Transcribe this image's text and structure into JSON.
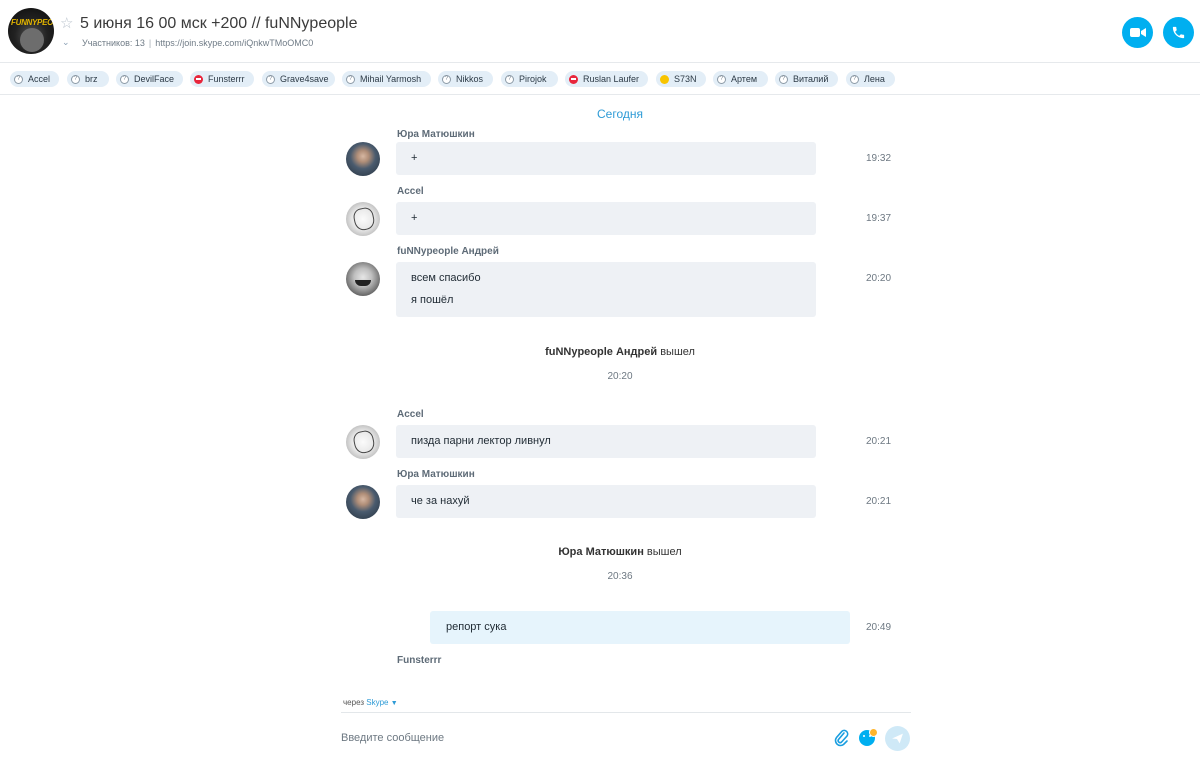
{
  "header": {
    "avatar_text": "FUNNYPEOPLE",
    "title": "5 июня 16 00 мск +200 // fuNNypeople",
    "participants": "Участников: 13",
    "separator": "|",
    "link": "https://join.skype.com/iQnkwTMoOMC0",
    "accent_color": "#00aff0"
  },
  "participants": [
    {
      "name": "Accel",
      "status": "unknown"
    },
    {
      "name": "brz",
      "status": "unknown"
    },
    {
      "name": "DevilFace",
      "status": "unknown"
    },
    {
      "name": "Funsterrr",
      "status": "dnd"
    },
    {
      "name": "Grave4save",
      "status": "unknown"
    },
    {
      "name": "Mihail Yarmosh",
      "status": "unknown"
    },
    {
      "name": "Nikkos",
      "status": "unknown"
    },
    {
      "name": "Pirojok",
      "status": "unknown"
    },
    {
      "name": "Ruslan Laufer",
      "status": "dnd"
    },
    {
      "name": "S73N",
      "status": "away"
    },
    {
      "name": "Артем",
      "status": "unknown"
    },
    {
      "name": "Виталий",
      "status": "unknown"
    },
    {
      "name": "Лена",
      "status": "unknown"
    }
  ],
  "chat": {
    "day_label": "Сегодня",
    "msg1": {
      "sender": "Юра Матюшкин",
      "text": "+",
      "time": "19:32"
    },
    "msg2": {
      "sender": "Accel",
      "text": "+",
      "time": "19:37"
    },
    "msg3": {
      "sender": "fuNNypeople Андрей",
      "lines": [
        "всем спасибо",
        "я пошёл"
      ],
      "time": "20:20"
    },
    "sys1": {
      "name": "fuNNypeople Андрей",
      "action": "вышел",
      "time": "20:20"
    },
    "msg4": {
      "sender": "Accel",
      "text": "пизда парни лектор ливнул",
      "time": "20:21"
    },
    "msg5": {
      "sender": "Юра Матюшкин",
      "text": "че за нахуй",
      "time": "20:21"
    },
    "sys2": {
      "name": "Юра Матюшкин",
      "action": "вышел",
      "time": "20:36"
    },
    "out1": {
      "text": "репорт сука",
      "time": "20:49"
    },
    "typing_sender": "Funsterrr"
  },
  "composer": {
    "via_label": "через",
    "via_service": "Skype",
    "placeholder": "Введите сообщение"
  }
}
